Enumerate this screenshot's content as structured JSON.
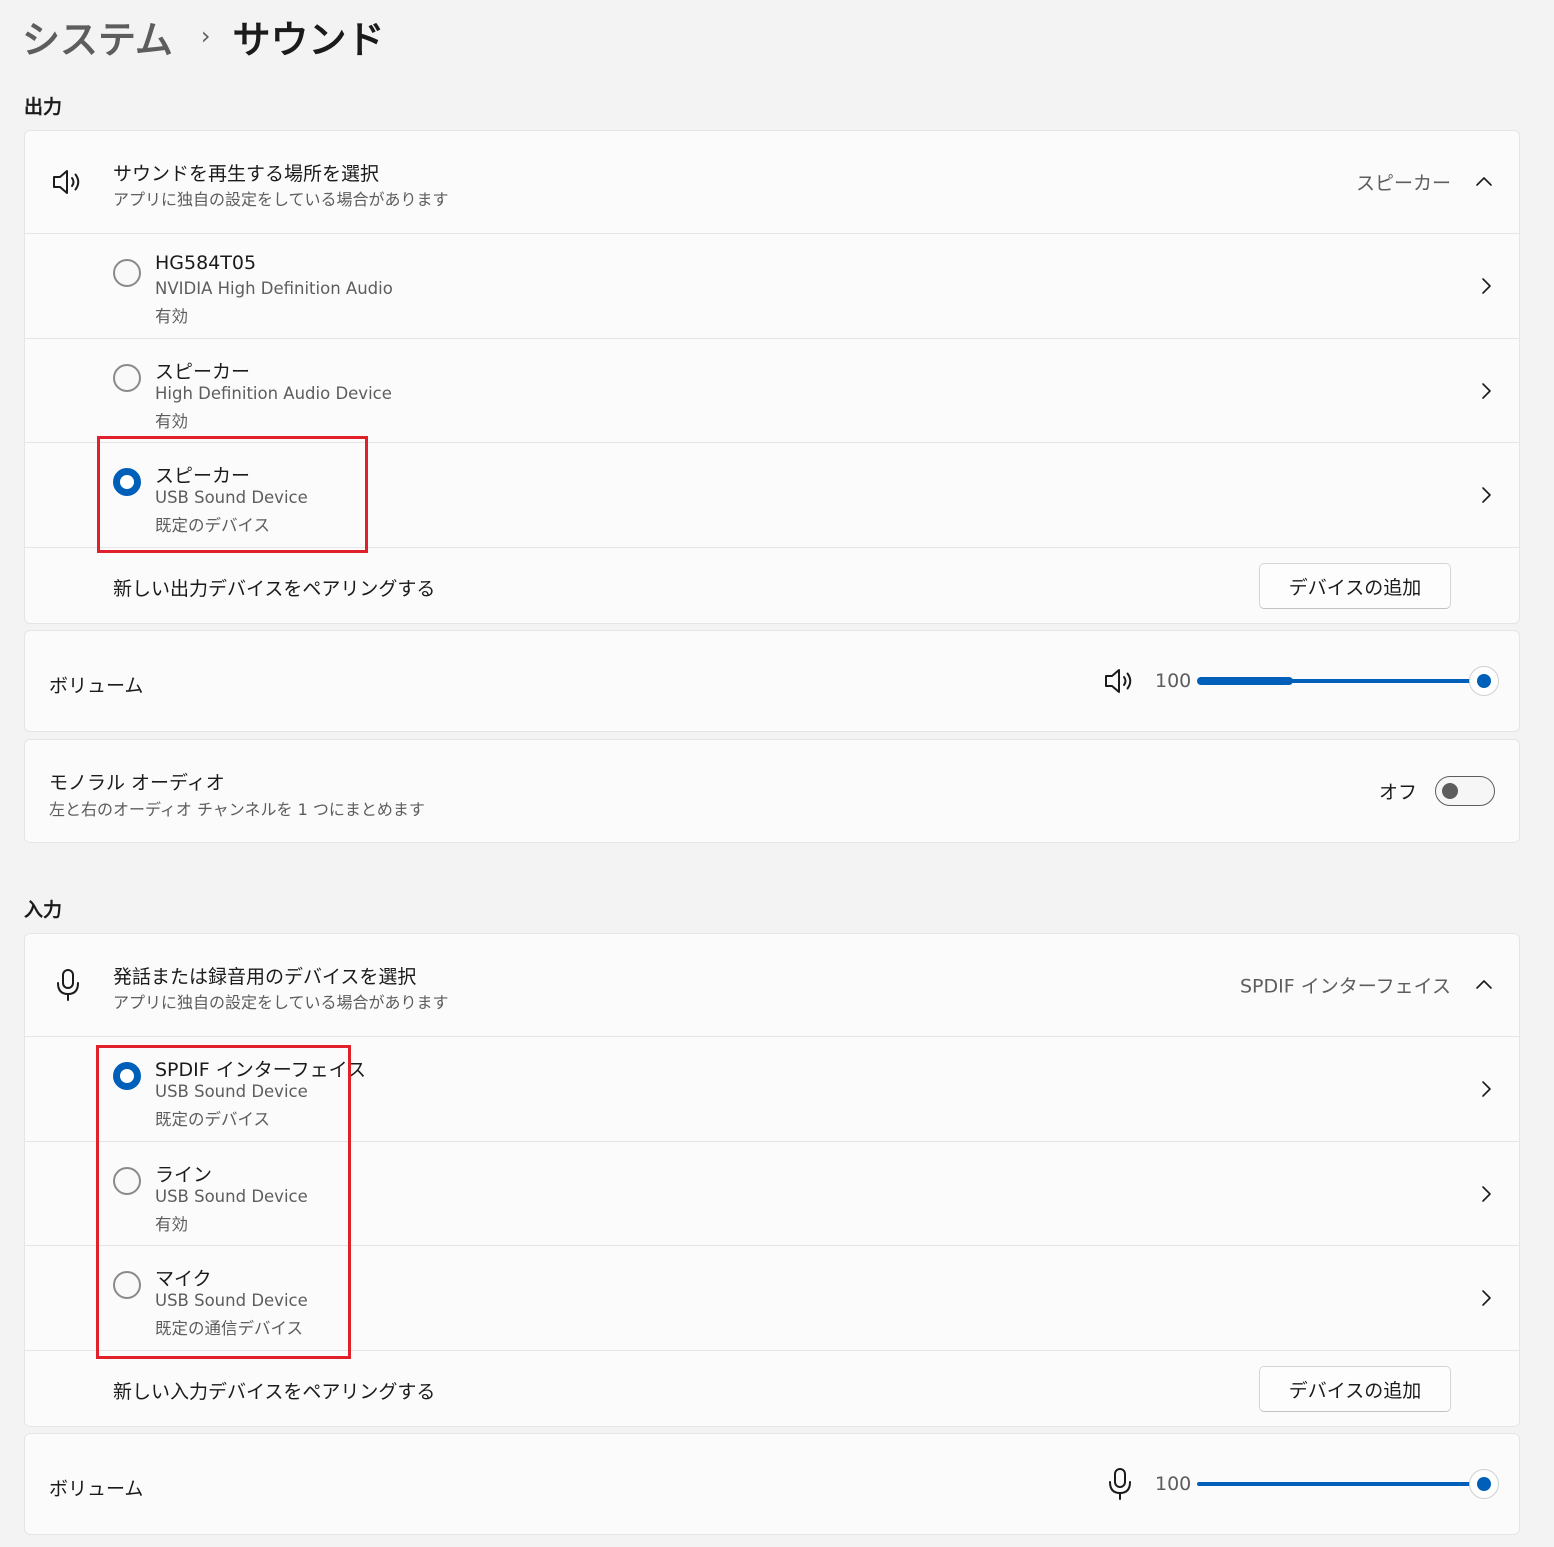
{
  "breadcrumb": {
    "parent": "システム",
    "separator": "›",
    "current": "サウンド"
  },
  "output": {
    "section_title": "出力",
    "selector": {
      "icon": "speaker-icon",
      "title": "サウンドを再生する場所を選択",
      "subtitle": "アプリに独自の設定をしている場合があります",
      "value": "スピーカー"
    },
    "devices": [
      {
        "name": "HG584T05",
        "driver": "NVIDIA High Definition Audio",
        "status": "有効",
        "selected": false
      },
      {
        "name": "スピーカー",
        "driver": "High Definition Audio Device",
        "status": "有効",
        "selected": false
      },
      {
        "name": "スピーカー",
        "driver": "USB Sound Device",
        "status": "既定のデバイス",
        "selected": true
      }
    ],
    "pair": {
      "label": "新しい出力デバイスをペアリングする",
      "button": "デバイスの追加"
    },
    "volume": {
      "label": "ボリューム",
      "value": "100",
      "icon": "speaker-icon"
    },
    "mono": {
      "title": "モノラル オーディオ",
      "subtitle": "左と右のオーディオ チャンネルを 1 つにまとめます",
      "state": "オフ"
    }
  },
  "input": {
    "section_title": "入力",
    "selector": {
      "icon": "microphone-icon",
      "title": "発話または録音用のデバイスを選択",
      "subtitle": "アプリに独自の設定をしている場合があります",
      "value": "SPDIF インターフェイス"
    },
    "devices": [
      {
        "name": "SPDIF インターフェイス",
        "driver": "USB Sound Device",
        "status": "既定のデバイス",
        "selected": true
      },
      {
        "name": "ライン",
        "driver": "USB Sound Device",
        "status": "有効",
        "selected": false
      },
      {
        "name": "マイク",
        "driver": "USB Sound Device",
        "status": "既定の通信デバイス",
        "selected": false
      }
    ],
    "pair": {
      "label": "新しい入力デバイスをペアリングする",
      "button": "デバイスの追加"
    },
    "volume": {
      "label": "ボリューム",
      "value": "100",
      "icon": "microphone-icon"
    }
  },
  "colors": {
    "accent": "#005fb8",
    "highlight": "#e0202a",
    "background": "#f3f3f3",
    "card": "#fbfbfb"
  }
}
